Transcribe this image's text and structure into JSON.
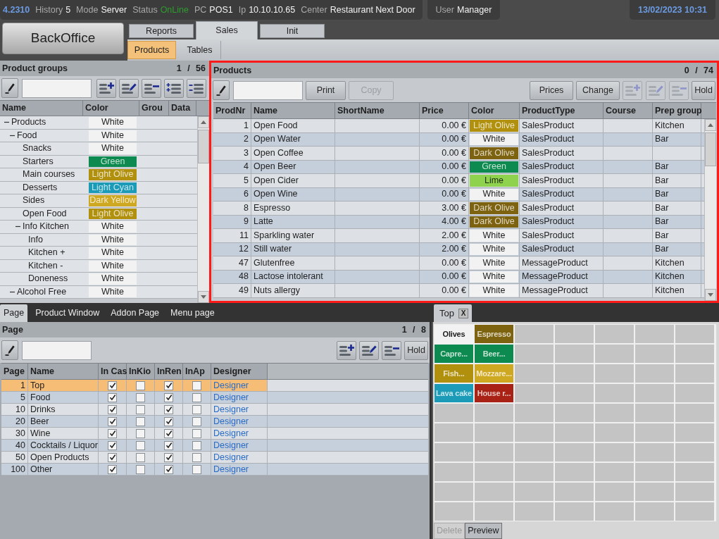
{
  "top_bar": {
    "version": "4.2310",
    "fields": [
      {
        "label": "History",
        "value": "5",
        "kind": "plain"
      },
      {
        "label": "Mode",
        "value": "Server",
        "kind": "plain"
      },
      {
        "label": "Status",
        "value": "OnLine",
        "kind": "status"
      },
      {
        "label": "PC",
        "value": "POS1",
        "kind": "plain"
      },
      {
        "label": "Ip",
        "value": "10.10.10.65",
        "kind": "plain"
      },
      {
        "label": "Center",
        "value": "Restaurant Next Door",
        "kind": "plain"
      }
    ],
    "user": {
      "label": "User",
      "value": "Manager"
    },
    "datetime": "13/02/2023 10:31"
  },
  "nav": {
    "app_button": "BackOffice",
    "tabs": [
      {
        "label": "Reports",
        "selected": false
      },
      {
        "label": "Sales",
        "selected": true
      },
      {
        "label": "Init",
        "selected": false
      }
    ],
    "subtabs": [
      {
        "label": "Products",
        "selected": true
      },
      {
        "label": "Tables",
        "selected": false
      }
    ]
  },
  "product_groups": {
    "title": "Product groups",
    "counter": "1 / 56",
    "icon_buttons": [
      {
        "kind": "add",
        "disabled": false
      },
      {
        "kind": "edit",
        "disabled": false
      },
      {
        "kind": "remove",
        "disabled": false
      },
      {
        "kind": "add_child",
        "disabled": false
      },
      {
        "kind": "remove_child",
        "disabled": false
      }
    ],
    "columns": [
      "Name",
      "Color",
      "Grou",
      "Data"
    ],
    "tree": [
      {
        "name": "Products",
        "color_name": "White",
        "color": "#f2f2f2",
        "expanded": true,
        "children": [
          {
            "name": "Food",
            "color_name": "White",
            "color": "#f2f2f2",
            "expanded": true,
            "children": [
              {
                "name": "Snacks",
                "color_name": "White",
                "color": "#f2f2f2"
              },
              {
                "name": "Starters",
                "color_name": "Green",
                "color": "#0d8a4f"
              },
              {
                "name": "Main courses",
                "color_name": "Light Olive",
                "color": "#b0900c"
              },
              {
                "name": "Desserts",
                "color_name": "Light Cyan",
                "color": "#1b9bb7"
              },
              {
                "name": "Sides",
                "color_name": "Dark Yellow",
                "color": "#cfa821"
              },
              {
                "name": "Open Food",
                "color_name": "Light Olive",
                "color": "#b0900c"
              },
              {
                "name": "Info Kitchen",
                "color_name": "White",
                "color": "#f2f2f2",
                "expanded": true,
                "children": [
                  {
                    "name": "Info",
                    "color_name": "White",
                    "color": "#f2f2f2"
                  },
                  {
                    "name": "Kitchen +",
                    "color_name": "White",
                    "color": "#f2f2f2"
                  },
                  {
                    "name": "Kitchen -",
                    "color_name": "White",
                    "color": "#f2f2f2"
                  },
                  {
                    "name": "Doneness",
                    "color_name": "White",
                    "color": "#f2f2f2"
                  }
                ]
              }
            ]
          },
          {
            "name": "Alcohol Free",
            "color_name": "White",
            "color": "#f2f2f2",
            "expanded": true
          }
        ]
      }
    ]
  },
  "products": {
    "title": "Products",
    "counter": "0 / 74",
    "left_buttons": [
      {
        "label": "Print",
        "disabled": false
      },
      {
        "label": "Copy",
        "disabled": true
      }
    ],
    "right_buttons": [
      {
        "label": "Prices",
        "disabled": false
      },
      {
        "label": "Change",
        "disabled": false
      }
    ],
    "icon_buttons": [
      {
        "kind": "add",
        "disabled": true
      },
      {
        "kind": "edit",
        "disabled": true
      },
      {
        "kind": "remove",
        "disabled": true
      }
    ],
    "hold_button": "Hold",
    "columns": [
      "ProdNr",
      "Name",
      "ShortName",
      "Price",
      "Color",
      "ProductType",
      "Course",
      "Prep group"
    ],
    "rows": [
      {
        "prod_nr": "1",
        "name": "Open Food",
        "price": "0.00 €",
        "color_name": "Light Olive",
        "color": "#b0900c",
        "product_type": "SalesProduct",
        "prep_group": "Kitchen"
      },
      {
        "prod_nr": "2",
        "name": "Open Water",
        "price": "0.00 €",
        "color_name": "White",
        "color": "#f2f2f2",
        "product_type": "SalesProduct",
        "prep_group": "Bar"
      },
      {
        "prod_nr": "3",
        "name": "Open Coffee",
        "price": "0.00 €",
        "color_name": "Dark Olive",
        "color": "#7d6210",
        "product_type": "SalesProduct"
      },
      {
        "prod_nr": "4",
        "name": "Open Beer",
        "price": "0.00 €",
        "color_name": "Green",
        "color": "#0d8a4f",
        "product_type": "SalesProduct",
        "prep_group": "Bar"
      },
      {
        "prod_nr": "5",
        "name": "Open Cider",
        "price": "0.00 €",
        "color_name": "Lime",
        "color": "#8fd24e",
        "product_type": "SalesProduct",
        "prep_group": "Bar"
      },
      {
        "prod_nr": "6",
        "name": "Open Wine",
        "price": "0.00 €",
        "color_name": "White",
        "color": "#f2f2f2",
        "product_type": "SalesProduct",
        "prep_group": "Bar"
      },
      {
        "prod_nr": "8",
        "name": "Espresso",
        "price": "3.00 €",
        "color_name": "Dark Olive",
        "color": "#7d6210",
        "product_type": "SalesProduct",
        "prep_group": "Bar"
      },
      {
        "prod_nr": "9",
        "name": "Latte",
        "price": "4.00 €",
        "color_name": "Dark Olive",
        "color": "#7d6210",
        "product_type": "SalesProduct",
        "prep_group": "Bar"
      },
      {
        "prod_nr": "11",
        "name": "Sparkling water",
        "price": "2.00 €",
        "color_name": "White",
        "color": "#f2f2f2",
        "product_type": "SalesProduct",
        "prep_group": "Bar"
      },
      {
        "prod_nr": "12",
        "name": "Still water",
        "price": "2.00 €",
        "color_name": "White",
        "color": "#f2f2f2",
        "product_type": "SalesProduct",
        "prep_group": "Bar"
      },
      {
        "prod_nr": "47",
        "name": "Glutenfree",
        "price": "0.00 €",
        "color_name": "White",
        "color": "#f2f2f2",
        "product_type": "MessageProduct",
        "prep_group": "Kitchen"
      },
      {
        "prod_nr": "48",
        "name": "Lactose intolerant",
        "price": "0.00 €",
        "color_name": "White",
        "color": "#f2f2f2",
        "product_type": "MessageProduct",
        "prep_group": "Kitchen"
      },
      {
        "prod_nr": "49",
        "name": "Nuts allergy",
        "price": "0.00 €",
        "color_name": "White",
        "color": "#f2f2f2",
        "product_type": "MessageProduct",
        "prep_group": "Kitchen"
      }
    ]
  },
  "page_tabs": [
    {
      "label": "Page",
      "selected": true
    },
    {
      "label": "Product Window",
      "selected": false
    },
    {
      "label": "Addon Page",
      "selected": false
    },
    {
      "label": "Menu page",
      "selected": false
    }
  ],
  "pages": {
    "title": "Page",
    "counter": "1 / 8",
    "icon_buttons": [
      {
        "kind": "add",
        "disabled": false
      },
      {
        "kind": "edit",
        "disabled": false
      },
      {
        "kind": "remove",
        "disabled": false
      }
    ],
    "hold_button": "Hold",
    "columns": [
      "Page",
      "Name",
      "In Cas",
      "InKio",
      "InRen",
      "InAp",
      "Designer"
    ],
    "rows": [
      {
        "page_nr": "1",
        "name": "Top",
        "selected": true,
        "flags": [
          {
            "checked": true
          },
          {
            "checked": false
          },
          {
            "checked": true
          },
          {
            "checked": false
          }
        ],
        "designer": "Designer"
      },
      {
        "page_nr": "5",
        "name": "Food",
        "selected": false,
        "flags": [
          {
            "checked": true
          },
          {
            "checked": false
          },
          {
            "checked": true
          },
          {
            "checked": false
          }
        ],
        "designer": "Designer"
      },
      {
        "page_nr": "10",
        "name": "Drinks",
        "selected": false,
        "flags": [
          {
            "checked": true
          },
          {
            "checked": false
          },
          {
            "checked": true
          },
          {
            "checked": false
          }
        ],
        "designer": "Designer"
      },
      {
        "page_nr": "20",
        "name": "Beer",
        "selected": false,
        "flags": [
          {
            "checked": true
          },
          {
            "checked": false
          },
          {
            "checked": true
          },
          {
            "checked": false
          }
        ],
        "designer": "Designer"
      },
      {
        "page_nr": "30",
        "name": "Wine",
        "selected": false,
        "flags": [
          {
            "checked": true
          },
          {
            "checked": false
          },
          {
            "checked": true
          },
          {
            "checked": false
          }
        ],
        "designer": "Designer"
      },
      {
        "page_nr": "40",
        "name": "Cocktails / Liquor",
        "selected": false,
        "flags": [
          {
            "checked": true
          },
          {
            "checked": false
          },
          {
            "checked": true
          },
          {
            "checked": false
          }
        ],
        "designer": "Designer"
      },
      {
        "page_nr": "50",
        "name": "Open Products",
        "selected": false,
        "flags": [
          {
            "checked": true
          },
          {
            "checked": false
          },
          {
            "checked": true
          },
          {
            "checked": false
          }
        ],
        "designer": "Designer"
      },
      {
        "page_nr": "100",
        "name": "Other",
        "selected": false,
        "flags": [
          {
            "checked": true
          },
          {
            "checked": false
          },
          {
            "checked": true
          },
          {
            "checked": false
          }
        ],
        "designer": "Designer"
      }
    ]
  },
  "designer": {
    "tab": "Top",
    "close": "X",
    "grid_rows": [
      {
        "buttons": [
          {
            "label": "Olives",
            "color": "#f2f2f2"
          },
          {
            "label": "Espresso",
            "color": "#7d6210"
          }
        ]
      },
      {
        "buttons": [
          {
            "label": "Capre...",
            "color": "#0d8a4f"
          },
          {
            "label": "Beer...",
            "color": "#0d8a4f"
          }
        ]
      },
      {
        "buttons": [
          {
            "label": "Fish...",
            "color": "#b0900c"
          },
          {
            "label": "Mozzare...",
            "color": "#cfa821"
          }
        ]
      },
      {
        "buttons": [
          {
            "label": "Lava cake",
            "color": "#1b9bb7"
          },
          {
            "label": "House r...",
            "color": "#a82215"
          }
        ]
      }
    ],
    "footer_buttons": [
      {
        "label": "Delete",
        "disabled": true
      },
      {
        "label": "Preview",
        "disabled": false
      }
    ]
  }
}
